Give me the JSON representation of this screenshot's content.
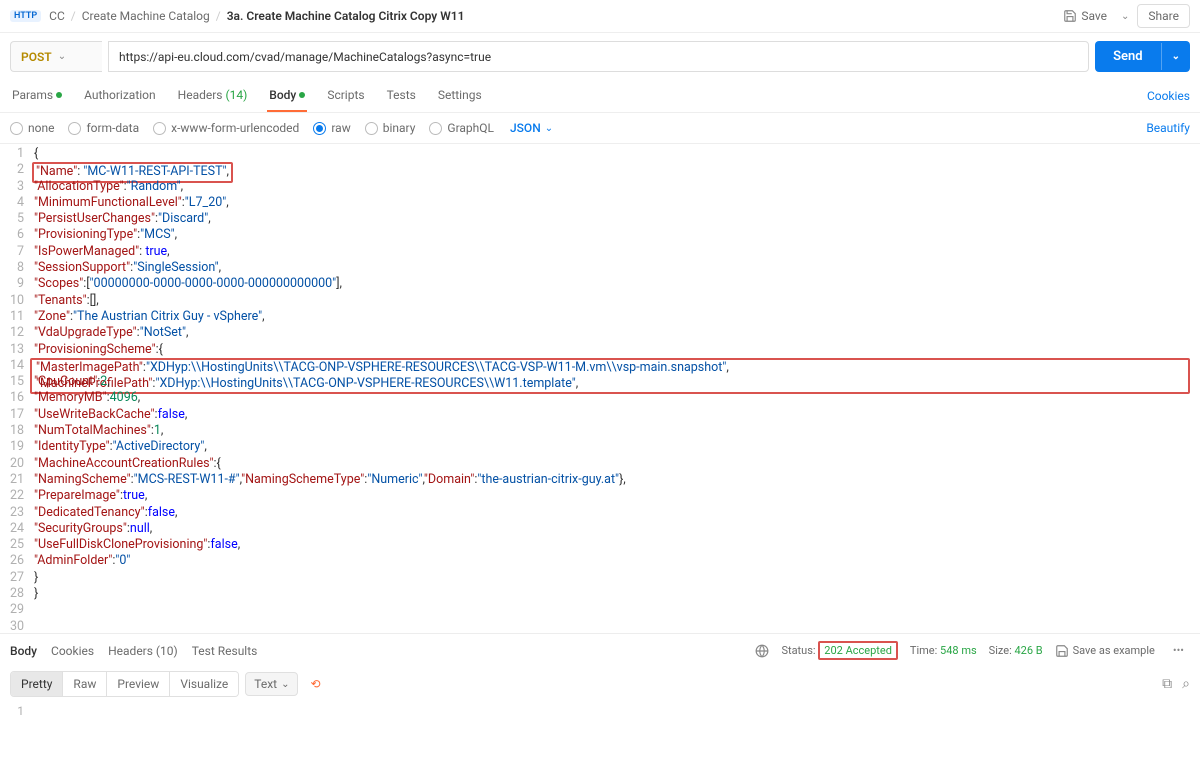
{
  "breadcrumb": {
    "root": "CC",
    "mid": "Create Machine Catalog",
    "current": "3a. Create Machine Catalog Citrix Copy W11"
  },
  "header": {
    "save": "Save",
    "share": "Share"
  },
  "request": {
    "method": "POST",
    "url": "https://api-eu.cloud.com/cvad/manage/MachineCatalogs?async=true",
    "send": "Send"
  },
  "tabs": {
    "params": "Params",
    "authorization": "Authorization",
    "headers": "Headers",
    "headers_count": "(14)",
    "body": "Body",
    "scripts": "Scripts",
    "tests": "Tests",
    "settings": "Settings",
    "cookies": "Cookies"
  },
  "bodyTypes": {
    "none": "none",
    "formdata": "form-data",
    "urlencoded": "x-www-form-urlencoded",
    "raw": "raw",
    "binary": "binary",
    "graphql": "GraphQL",
    "format": "JSON",
    "beautify": "Beautify"
  },
  "code": {
    "l1": "{",
    "l2_k": "\"Name\"",
    "l2_v": "\"MC-W11-REST-API-TEST\"",
    "l3_k": "\"AllocationType\"",
    "l3_v": "\"Random\"",
    "l4_k": "\"MinimumFunctionalLevel\"",
    "l4_v": "\"L7_20\"",
    "l5_k": "\"PersistUserChanges\"",
    "l5_v": "\"Discard\"",
    "l6_k": "\"ProvisioningType\"",
    "l6_v": "\"MCS\"",
    "l7_k": "\"IsPowerManaged\"",
    "l7_v": "true",
    "l8_k": "\"SessionSupport\"",
    "l8_v": "\"SingleSession\"",
    "l9_k": "\"Scopes\"",
    "l9_v": "\"00000000-0000-0000-0000-000000000000\"",
    "l10_k": "\"Tenants\"",
    "l11_k": "\"Zone\"",
    "l11_v": "\"The Austrian Citrix Guy - vSphere\"",
    "l12_k": "\"VdaUpgradeType\"",
    "l12_v": "\"NotSet\"",
    "l13_k": "\"ProvisioningScheme\"",
    "l14_k": "\"MasterImagePath\"",
    "l14_v": "\"XDHyp:\\\\HostingUnits\\\\TACG-ONP-VSPHERE-RESOURCES\\\\TACG-VSP-W11-M.vm\\\\vsp-main.snapshot\"",
    "l15_k": "\"MachineProfilePath\"",
    "l15_v": "\"XDHyp:\\\\HostingUnits\\\\TACG-ONP-VSPHERE-RESOURCES\\\\W11.template\"",
    "l16_k": "\"CpuCount\"",
    "l16_v": "2",
    "l17_k": "\"MemoryMB\"",
    "l17_v": "4096",
    "l18_k": "\"UseWriteBackCache\"",
    "l18_v": "false",
    "l19_k": "\"NumTotalMachines\"",
    "l19_v": "1",
    "l20_k": "\"IdentityType\"",
    "l20_v": "\"ActiveDirectory\"",
    "l21_k": "\"MachineAccountCreationRules\"",
    "l22_k1": "\"NamingScheme\"",
    "l22_v1": "\"MCS-REST-W11-#\"",
    "l22_k2": "\"NamingSchemeType\"",
    "l22_v2": "\"Numeric\"",
    "l22_k3": "\"Domain\"",
    "l22_v3": "\"the-austrian-citrix-guy.at\"",
    "l23_k": "\"PrepareImage\"",
    "l23_v": "true",
    "l24_k": "\"DedicatedTenancy\"",
    "l24_v": "false",
    "l25_k": "\"SecurityGroups\"",
    "l25_v": "null",
    "l26_k": "\"UseFullDiskCloneProvisioning\"",
    "l26_v": "false",
    "l27_k": "\"AdminFolder\"",
    "l27_v": "\"0\"",
    "l28": "}",
    "l29": "}"
  },
  "respTabs": {
    "body": "Body",
    "cookies": "Cookies",
    "headers": "Headers",
    "headers_count": "(10)",
    "testResults": "Test Results"
  },
  "respStatus": {
    "statusLabel": "Status:",
    "statusValue": "202 Accepted",
    "timeLabel": "Time:",
    "timeValue": "548 ms",
    "sizeLabel": "Size:",
    "sizeValue": "426 B",
    "saveExample": "Save as example"
  },
  "respToolbar": {
    "pretty": "Pretty",
    "raw": "Raw",
    "preview": "Preview",
    "visualize": "Visualize",
    "text": "Text"
  }
}
